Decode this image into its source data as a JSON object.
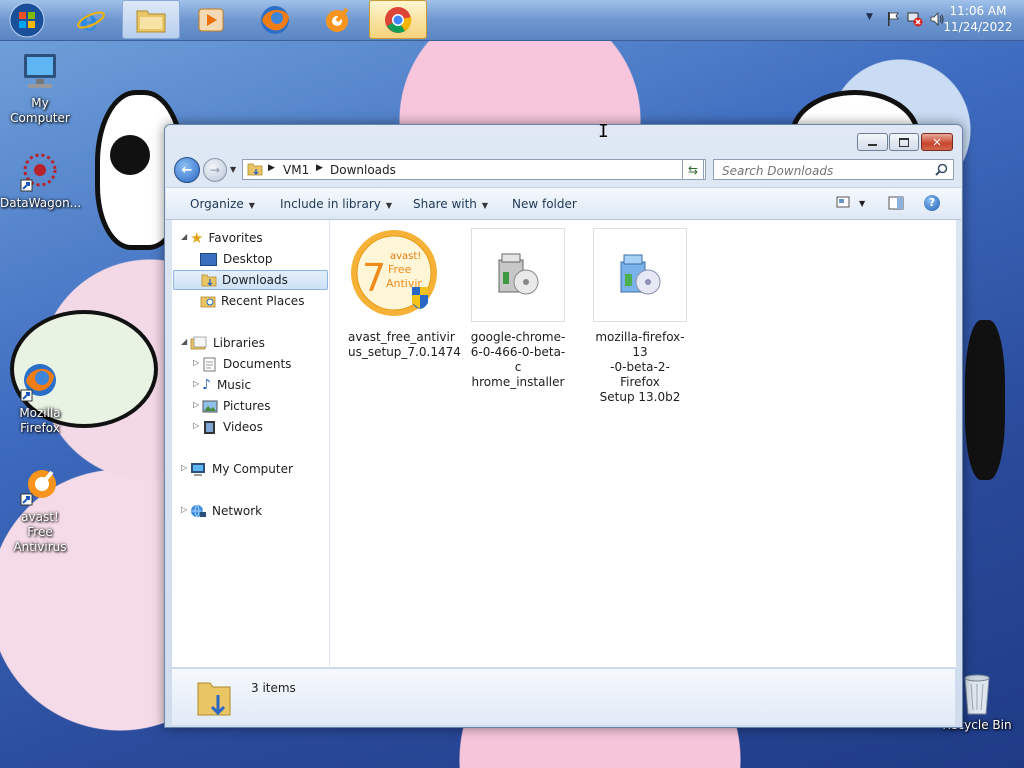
{
  "taskbar": {
    "buttons": [
      {
        "name": "start-button",
        "state": "normal"
      },
      {
        "name": "internet-explorer",
        "state": "normal"
      },
      {
        "name": "windows-explorer",
        "state": "open"
      },
      {
        "name": "media-player",
        "state": "normal"
      },
      {
        "name": "firefox",
        "state": "normal"
      },
      {
        "name": "avast",
        "state": "normal"
      },
      {
        "name": "chrome",
        "state": "active"
      }
    ],
    "clock": {
      "time": "11:06 AM",
      "date": "11/24/2022"
    }
  },
  "desktop": {
    "icons": [
      {
        "id": "my-computer",
        "label": "My Computer"
      },
      {
        "id": "datawagon",
        "label": "DataWagon..."
      },
      {
        "id": "mozilla-firefox",
        "label": "Mozilla Firefox"
      },
      {
        "id": "avast",
        "label": "avast! Free Antivirus"
      },
      {
        "id": "recycle-bin",
        "label": "Recycle Bin"
      }
    ]
  },
  "window": {
    "address": {
      "root": "VM1",
      "current": "Downloads"
    },
    "search": {
      "placeholder": "Search Downloads"
    },
    "commands": {
      "organize": "Organize",
      "include": "Include in library",
      "share": "Share with",
      "new_folder": "New folder"
    },
    "nav": {
      "favorites": "Favorites",
      "desktop": "Desktop",
      "downloads": "Downloads",
      "recent": "Recent Places",
      "libraries": "Libraries",
      "documents": "Documents",
      "music": "Music",
      "pictures": "Pictures",
      "videos": "Videos",
      "my_computer": "My Computer",
      "network": "Network"
    },
    "files": [
      {
        "line1": "avast_free_antivir",
        "line2": "us_setup_7.0.1474",
        "line3": ""
      },
      {
        "line1": "google-chrome-",
        "line2": "6-0-466-0-beta-c",
        "line3": "hrome_installer"
      },
      {
        "line1": "mozilla-firefox-13",
        "line2": "-0-beta-2-Firefox",
        "line3": "Setup 13.0b2"
      }
    ],
    "status": {
      "count": "3 items"
    }
  },
  "colors": {
    "accent": "#3b6fb6",
    "selection": "#cde2f8",
    "close": "#c8452c"
  }
}
